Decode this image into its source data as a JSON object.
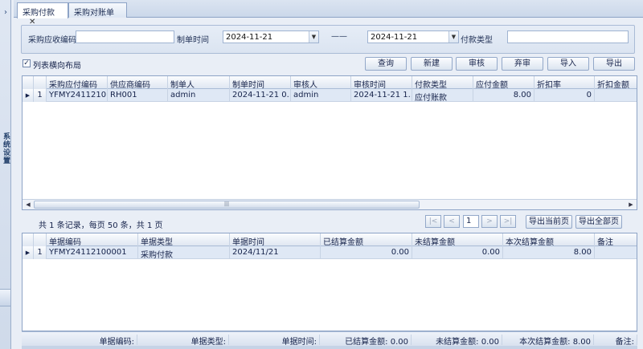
{
  "leftbar": {
    "arrow": "›",
    "vertical_label": "系统设置"
  },
  "tabs": [
    {
      "label": "采购付款",
      "close": "✕"
    },
    {
      "label": "采购对账单"
    }
  ],
  "filter": {
    "code_label": "采购应收编码",
    "code_value": "",
    "date_label": "制单时间",
    "date_from": "2024-11-21",
    "date_sep": "——",
    "date_to": "2024-11-21",
    "pay_type_label": "付款类型",
    "pay_type_value": ""
  },
  "toolbar": {
    "checkbox_label": "列表横向布局",
    "checked_mark": "✓",
    "buttons": [
      "查询",
      "新建",
      "审核",
      "弃审",
      "导入",
      "导出"
    ]
  },
  "main_grid": {
    "columns": [
      "采购应付编码",
      "供应商编码",
      "制单人",
      "制单时间",
      "审核人",
      "审核时间",
      "付款类型",
      "应付金额",
      "折扣率",
      "折扣金额"
    ],
    "rows": [
      {
        "indicator": "▶",
        "num": "1",
        "cells": [
          "YFMY2411210...",
          "RH001",
          "admin",
          "2024-11-21 0...",
          "admin",
          "2024-11-21 1...",
          "应付账款",
          "8.00",
          "0",
          ""
        ]
      }
    ]
  },
  "paging": {
    "info": "共 1 条记录，每页 50 条，共 1 页",
    "first": "|<",
    "prev": "<",
    "page": "1",
    "next": ">",
    "last": ">|",
    "export_current": "导出当前页",
    "export_all": "导出全部页"
  },
  "detail_grid": {
    "columns": [
      "单据编码",
      "单据类型",
      "单据时间",
      "已结算金额",
      "未结算金额",
      "本次结算金额",
      "备注"
    ],
    "rows": [
      {
        "indicator": "▶",
        "num": "1",
        "cells": [
          "YFMY24112100001",
          "采购付款",
          "2024/11/21",
          "0.00",
          "0.00",
          "8.00",
          ""
        ]
      }
    ]
  },
  "summary": [
    "单据编码:",
    "单据类型:",
    "单据时间:",
    "已结算金额: 0.00",
    "未结算金额: 0.00",
    "本次结算金额: 8.00",
    "备注:"
  ]
}
